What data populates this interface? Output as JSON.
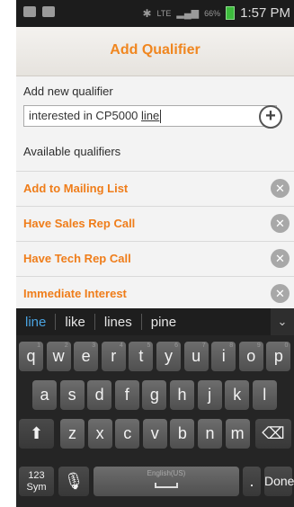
{
  "status_bar": {
    "network": "LTE",
    "battery_pct": "66%",
    "time": "1:57 PM"
  },
  "header": {
    "title": "Add Qualifier"
  },
  "form": {
    "new_label": "Add new qualifier",
    "input_text": "interested in CP5000 ",
    "input_text_underlined": "line",
    "add_glyph": "+",
    "available_label": "Available qualifiers"
  },
  "qualifiers": [
    "Add to Mailing List",
    "Have Sales Rep Call",
    "Have Tech Rep Call",
    "Immediate Interest"
  ],
  "suggestions": [
    "line",
    "like",
    "lines",
    "pine"
  ],
  "keyboard": {
    "row1": [
      "q",
      "w",
      "e",
      "r",
      "t",
      "y",
      "u",
      "i",
      "o",
      "p"
    ],
    "row1_hints": [
      "1",
      "2",
      "3",
      "4",
      "5",
      "6",
      "7",
      "8",
      "9",
      "0"
    ],
    "row2": [
      "a",
      "s",
      "d",
      "f",
      "g",
      "h",
      "j",
      "k",
      "l"
    ],
    "row3": [
      "z",
      "x",
      "c",
      "v",
      "b",
      "n",
      "m"
    ],
    "symbols_label": "123\nSym",
    "space_label": "English(US)",
    "period_label": ".",
    "done_label": "Done"
  }
}
